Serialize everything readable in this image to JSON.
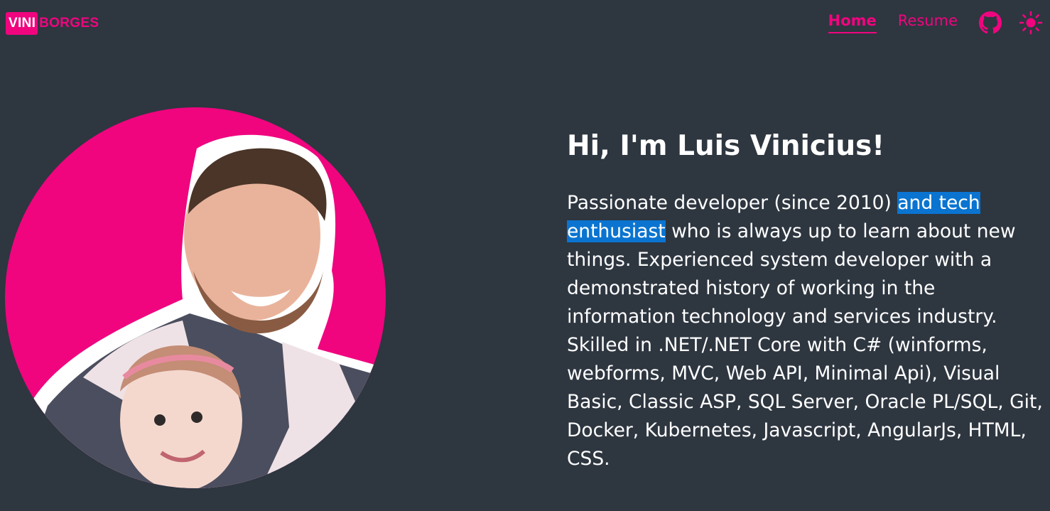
{
  "header": {
    "logo": {
      "box_text": "VINI",
      "rest_text": "BORGES"
    },
    "nav": [
      {
        "label": "Home",
        "active": true
      },
      {
        "label": "Resume",
        "active": false
      }
    ],
    "github_icon": "github-icon",
    "theme_icon": "sun-icon"
  },
  "hero": {
    "avatar_alt": "avatar-photo",
    "title": "Hi, I'm Luis Vinicius!",
    "bio_pre": "Passionate developer (since 2010) ",
    "bio_highlight": "and tech enthusiast",
    "bio_post": " who is always up to learn about new things. Experienced system developer with a demonstrated history of working in the information technology and services industry. Skilled in .NET/.NET Core with C# (winforms, webforms, MVC, Web API, Minimal Api), Visual Basic, Classic ASP, SQL Server, Oracle PL/SQL, Git, Docker, Kubernetes, Javascript, AngularJs, HTML, CSS."
  },
  "colors": {
    "background": "#2e3640",
    "accent": "#f0057f",
    "selection": "#0a74d0",
    "text": "#ffffff"
  }
}
